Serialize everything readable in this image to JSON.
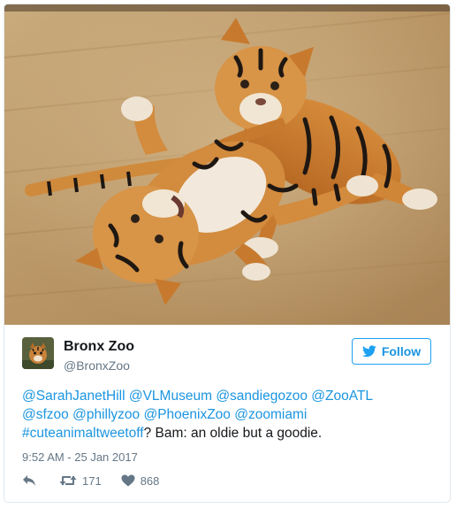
{
  "author": {
    "name": "Bronx Zoo",
    "handle": "@BronxZoo"
  },
  "follow_button": {
    "label": "Follow",
    "icon": "bird-icon"
  },
  "tweet": {
    "mentions_line1": [
      "@SarahJanetHill",
      "@VLMuseum",
      "@sandiegozoo",
      "@ZooATL"
    ],
    "mentions_line2": [
      "@sfzoo",
      "@phillyzoo",
      "@PhoenixZoo",
      "@zoomiami"
    ],
    "hashtag": "#cuteanimaltweetoff",
    "text_after": "? Bam: an oldie but a goodie."
  },
  "timestamp": "9:52 AM - 25 Jan 2017",
  "actions": {
    "reply_icon": "reply-icon",
    "retweet_icon": "retweet-icon",
    "retweet_count": "171",
    "like_icon": "heart-icon",
    "like_count": "868"
  },
  "colors": {
    "link": "#1b95e0",
    "text": "#14171a",
    "muted": "#657786",
    "border": "#e1e8ed"
  }
}
